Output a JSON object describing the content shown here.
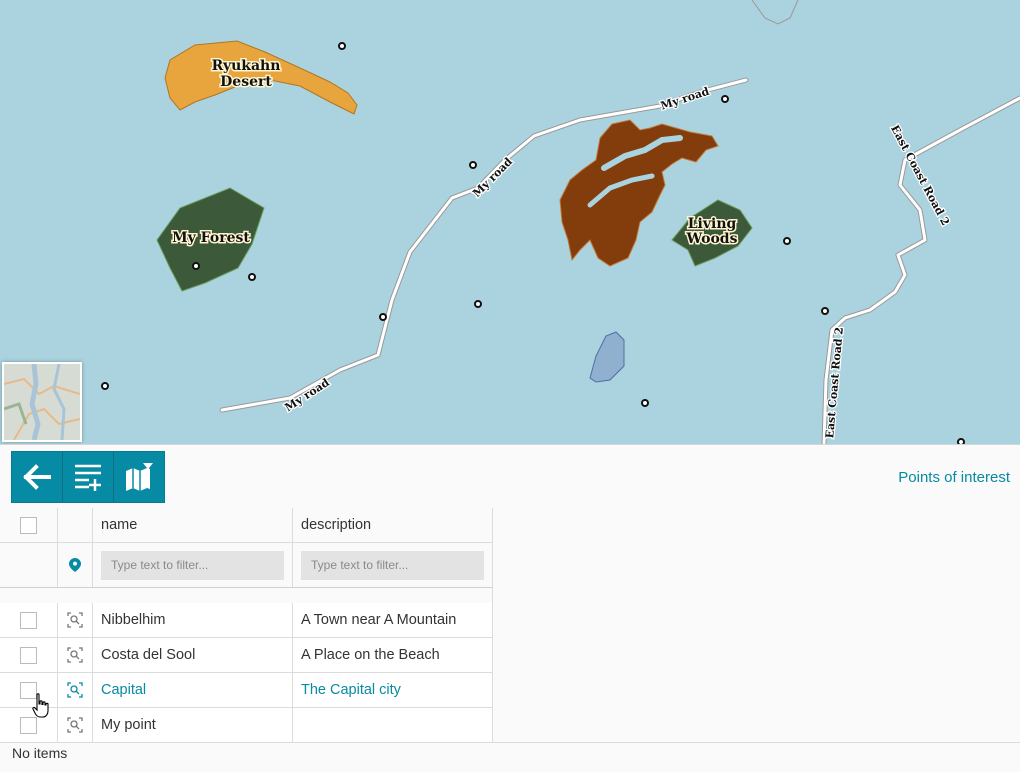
{
  "map": {
    "labels": {
      "desert_line1": "Ryukahn",
      "desert_line2": "Desert",
      "forest": "My Forest",
      "woods_line1": "Living",
      "woods_line2": "Woods",
      "road_top": "My road",
      "road_mid": "My road",
      "road_bottom": "My road",
      "east_coast_1": "East Coast Road 2",
      "east_coast_2": "East Coast Road 2"
    },
    "colors": {
      "water": "#aad3df",
      "desert": "#e8a43d",
      "forest": "#3c5a3a",
      "brown_area": "#833c0c",
      "lake": "#8fb0cf"
    }
  },
  "toolbar": {
    "back": "back-icon",
    "add_row": "list-plus-icon",
    "map_filter": "map-filter-icon"
  },
  "layer_title": "Points of interest",
  "table": {
    "columns": {
      "name": "name",
      "description": "description"
    },
    "filters": {
      "name_placeholder": "Type text to filter...",
      "description_placeholder": "Type text to filter..."
    },
    "rows": [
      {
        "name": "Nibbelhim",
        "description": "A Town near A Mountain",
        "selected": false
      },
      {
        "name": "Costa del Sool",
        "description": "A Place on the Beach",
        "selected": false
      },
      {
        "name": "Capital",
        "description": "The Capital city",
        "selected": true
      },
      {
        "name": "My point",
        "description": "",
        "selected": false
      }
    ]
  },
  "footer": {
    "status": "No items"
  }
}
